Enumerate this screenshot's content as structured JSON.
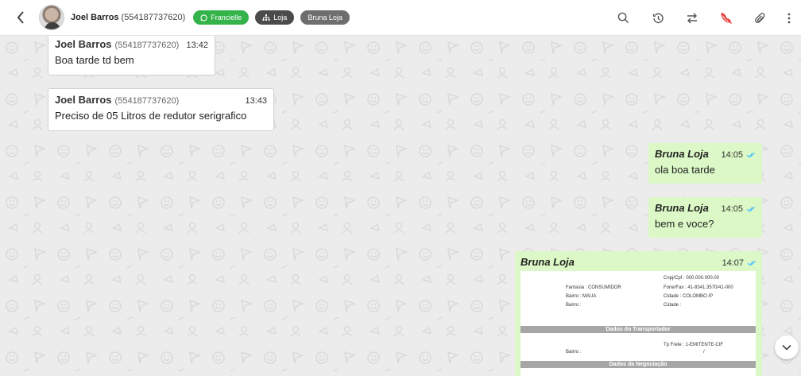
{
  "header": {
    "contact_name": "Joel Barros",
    "contact_phone": "(554187737620)",
    "tags": [
      {
        "label": "Francielle",
        "icon": "whatsapp-icon",
        "color": "#34b34a"
      },
      {
        "label": "Loja",
        "icon": "sitemap-icon",
        "color": "#4b4b4b"
      },
      {
        "label": "Bruna Loja",
        "icon": "",
        "color": "#6e6e6e"
      }
    ],
    "tools": [
      "search-icon",
      "history-icon",
      "transfer-icon",
      "no-phone-icon",
      "attach-icon",
      "more-icon"
    ]
  },
  "messages": [
    {
      "direction": "in",
      "sender": "Joel Barros",
      "phone": "(554187737620)",
      "time": "13:42",
      "text": "Boa tarde td bem"
    },
    {
      "direction": "in",
      "sender": "Joel Barros",
      "phone": "(554187737620)",
      "time": "13:43",
      "text": "Preciso de 05 Litros de redutor serigrafico"
    },
    {
      "direction": "out",
      "sender": "Bruna Loja",
      "time": "14:05",
      "text": "ola boa tarde",
      "status": "read"
    },
    {
      "direction": "out",
      "sender": "Bruna Loja",
      "time": "14:05",
      "text": "bem e voce?",
      "status": "read"
    },
    {
      "direction": "out",
      "sender": "Bruna Loja",
      "time": "14:07",
      "status": "read",
      "document": {
        "rows": [
          "Cnpj/Cpf   :   000.000.000.00",
          "Fantasia   :   CONSUMIDOR",
          "Fone/Fax   :   41-8341.3570/41-000",
          "Bairro   :   MAUA",
          "Cidade   :   COLOMBO        /P",
          "Bairro   :",
          "Cidade   :",
          "Tp Frete   :   1-EMITENTE-CIF",
          "Bairro   :",
          "/"
        ],
        "bands": [
          "Dados do Transportador",
          "Dados da Negociação"
        ]
      }
    }
  ],
  "colors": {
    "outgoing_bubble": "#dcf8c6",
    "incoming_bubble": "#ffffff",
    "read_ticks": "#4fc3f7",
    "no_phone_icon": "#e53935"
  }
}
